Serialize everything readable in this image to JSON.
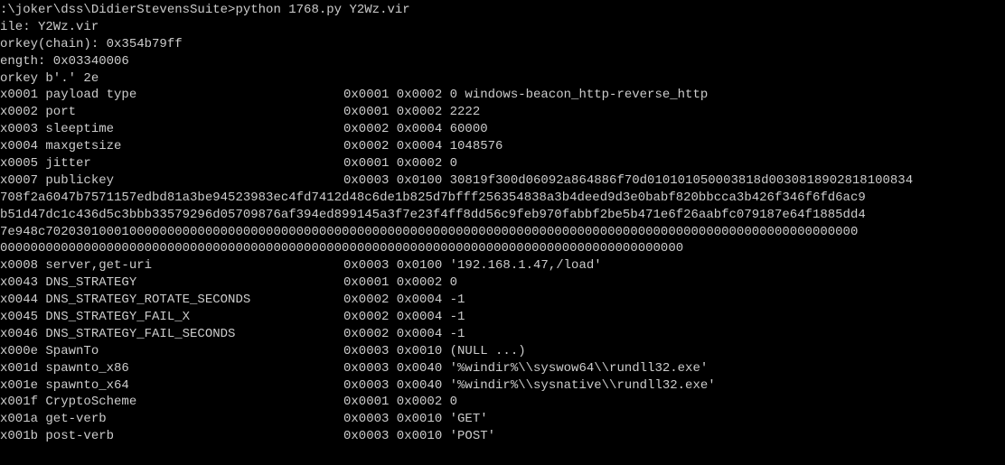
{
  "prompt": ":\\joker\\dss\\DidierStevensSuite>python 1768.py Y2Wz.vir",
  "header": {
    "file": "ile: Y2Wz.vir",
    "orkey_chain": "orkey(chain): 0x354b79ff",
    "length": "ength: 0x03340006",
    "orkey_b": "orkey b'.' 2e"
  },
  "rows": [
    {
      "id": "x0001",
      "name": "payload type",
      "c1": "0x0001",
      "c2": "0x0002",
      "val": "0 windows-beacon_http-reverse_http"
    },
    {
      "id": "x0002",
      "name": "port",
      "c1": "0x0001",
      "c2": "0x0002",
      "val": "2222"
    },
    {
      "id": "x0003",
      "name": "sleeptime",
      "c1": "0x0002",
      "c2": "0x0004",
      "val": "60000"
    },
    {
      "id": "x0004",
      "name": "maxgetsize",
      "c1": "0x0002",
      "c2": "0x0004",
      "val": "1048576"
    },
    {
      "id": "x0005",
      "name": "jitter",
      "c1": "0x0001",
      "c2": "0x0002",
      "val": "0"
    },
    {
      "id": "x0007",
      "name": "publickey",
      "c1": "0x0003",
      "c2": "0x0100",
      "val": "30819f300d06092a864886f70d010101050003818d0030818902818100834"
    }
  ],
  "publickey_cont": [
    "708f2a6047b7571157edbd81a3be94523983ec4fd7412d48c6de1b825d7bfff256354838a3b4deed9d3e0babf820bbcca3b426f346f6fd6ac9",
    "b51d47dc1c436d5c3bbb33579296d05709876af394ed899145a3f7e23f4ff8dd56c9feb970fabbf2be5b471e6f26aabfc079187e64f1885dd4",
    "7e948c70203010001000000000000000000000000000000000000000000000000000000000000000000000000000000000000000000000000",
    "000000000000000000000000000000000000000000000000000000000000000000000000000000000000000000"
  ],
  "rows2": [
    {
      "id": "x0008",
      "name": "server,get-uri",
      "c1": "0x0003",
      "c2": "0x0100",
      "val": "'192.168.1.47,/load'"
    },
    {
      "id": "x0043",
      "name": "DNS_STRATEGY",
      "c1": "0x0001",
      "c2": "0x0002",
      "val": "0"
    },
    {
      "id": "x0044",
      "name": "DNS_STRATEGY_ROTATE_SECONDS",
      "c1": "0x0002",
      "c2": "0x0004",
      "val": "-1"
    },
    {
      "id": "x0045",
      "name": "DNS_STRATEGY_FAIL_X",
      "c1": "0x0002",
      "c2": "0x0004",
      "val": "-1"
    },
    {
      "id": "x0046",
      "name": "DNS_STRATEGY_FAIL_SECONDS",
      "c1": "0x0002",
      "c2": "0x0004",
      "val": "-1"
    },
    {
      "id": "x000e",
      "name": "SpawnTo",
      "c1": "0x0003",
      "c2": "0x0010",
      "val": "(NULL ...)"
    },
    {
      "id": "x001d",
      "name": "spawnto_x86",
      "c1": "0x0003",
      "c2": "0x0040",
      "val": "'%windir%\\\\syswow64\\\\rundll32.exe'"
    },
    {
      "id": "x001e",
      "name": "spawnto_x64",
      "c1": "0x0003",
      "c2": "0x0040",
      "val": "'%windir%\\\\sysnative\\\\rundll32.exe'"
    },
    {
      "id": "x001f",
      "name": "CryptoScheme",
      "c1": "0x0001",
      "c2": "0x0002",
      "val": "0"
    },
    {
      "id": "x001a",
      "name": "get-verb",
      "c1": "0x0003",
      "c2": "0x0010",
      "val": "'GET'"
    },
    {
      "id": "x001b",
      "name": "post-verb",
      "c1": "0x0003",
      "c2": "0x0010",
      "val": "'POST'"
    }
  ]
}
